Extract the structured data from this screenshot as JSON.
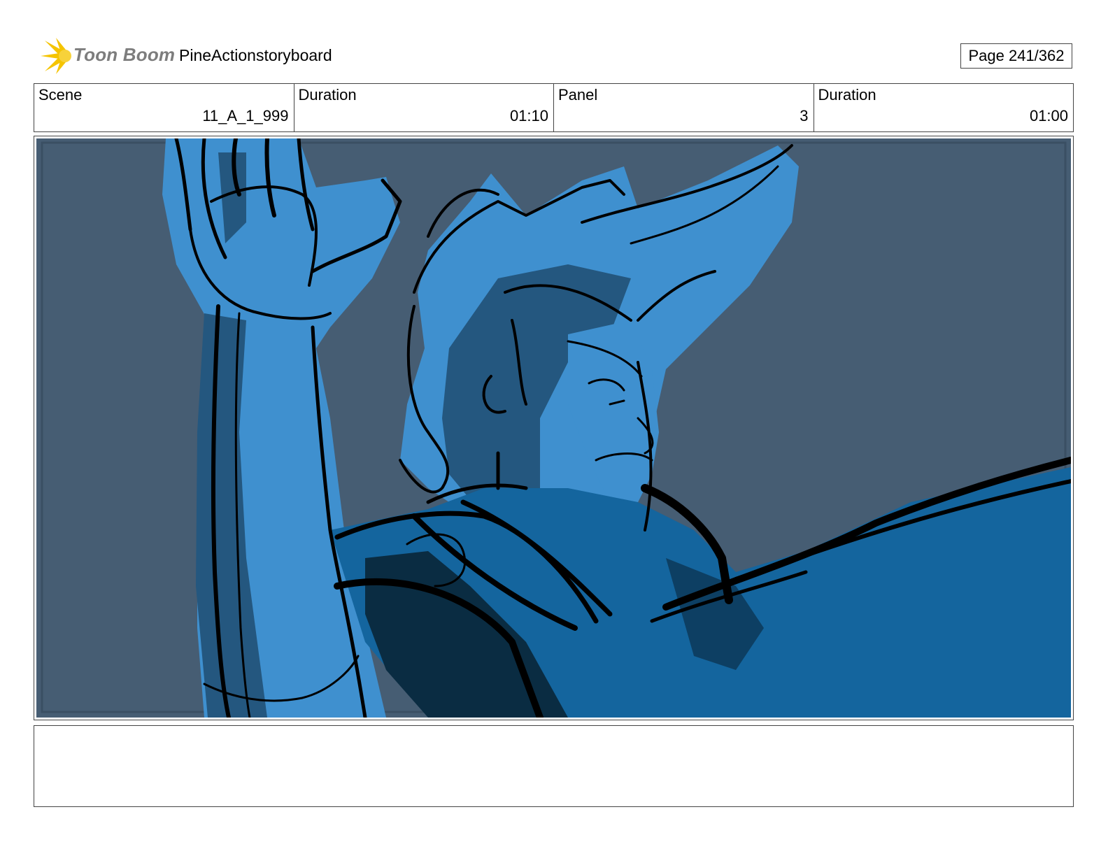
{
  "header": {
    "logo_text": "Toon Boom",
    "project_title": "PineActionstoryboard",
    "page_label": "Page 241/362"
  },
  "info": {
    "scene_label": "Scene",
    "scene_value": "11_A_1_999",
    "scene_duration_label": "Duration",
    "scene_duration_value": "01:10",
    "panel_label": "Panel",
    "panel_value": "3",
    "panel_duration_label": "Duration",
    "panel_duration_value": "01:00"
  },
  "panel": {
    "image_description": "storyboard-sketch-raised-arm-character",
    "colors": {
      "background": "#465d73",
      "light_blue": "#3f90cf",
      "mid_blue": "#24577f",
      "deep_blue": "#14659e",
      "shadow": "#0a2c42",
      "ink": "#000000"
    }
  },
  "caption": {
    "text": ""
  }
}
